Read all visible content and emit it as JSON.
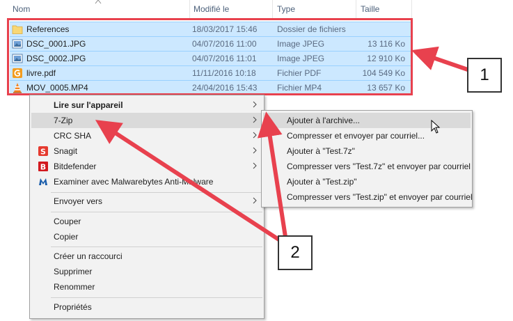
{
  "columns": {
    "name": "Nom",
    "modified": "Modifié le",
    "type": "Type",
    "size": "Taille"
  },
  "files": [
    {
      "name": "References",
      "date": "18/03/2017 15:46",
      "type": "Dossier de fichiers",
      "size": "",
      "icon": "folder-icon"
    },
    {
      "name": "DSC_0001.JPG",
      "date": "04/07/2016 11:00",
      "type": "Image JPEG",
      "size": "13 116 Ko",
      "icon": "image-icon"
    },
    {
      "name": "DSC_0002.JPG",
      "date": "04/07/2016 11:01",
      "type": "Image JPEG",
      "size": "12 910 Ko",
      "icon": "image-icon"
    },
    {
      "name": "livre.pdf",
      "date": "11/11/2016 10:18",
      "type": "Fichier PDF",
      "size": "104 549 Ko",
      "icon": "pdf-icon"
    },
    {
      "name": "MOV_0005.MP4",
      "date": "24/04/2016 15:43",
      "type": "Fichier MP4",
      "size": "13 657 Ko",
      "icon": "vlc-icon"
    }
  ],
  "context_menu": {
    "items": {
      "play_on_device": "Lire sur l'appareil",
      "seven_zip": "7-Zip",
      "crc_sha": "CRC SHA",
      "snagit": "Snagit",
      "bitdefender": "Bitdefender",
      "malwarebytes": "Examiner avec Malwarebytes Anti-Malware",
      "send_to": "Envoyer vers",
      "cut": "Couper",
      "copy": "Copier",
      "create_shortcut": "Créer un raccourci",
      "delete": "Supprimer",
      "rename": "Renommer",
      "properties": "Propriétés"
    }
  },
  "submenu_7zip": {
    "items": {
      "add_to_archive": "Ajouter à l'archive...",
      "compress_email": "Compresser et envoyer par courriel...",
      "add_to_7z": "Ajouter à \"Test.7z\"",
      "compress_7z_email": "Compresser vers \"Test.7z\" et envoyer par courriel",
      "add_to_zip": "Ajouter à \"Test.zip\"",
      "compress_zip_email": "Compresser vers \"Test.zip\" et envoyer par courriel"
    }
  },
  "callouts": {
    "one": "1",
    "two": "2"
  },
  "colors": {
    "selection": "#cce8ff",
    "annotation_red": "#e8414e",
    "menu_bg": "#f2f2f2",
    "menu_highlight": "#dadada"
  }
}
